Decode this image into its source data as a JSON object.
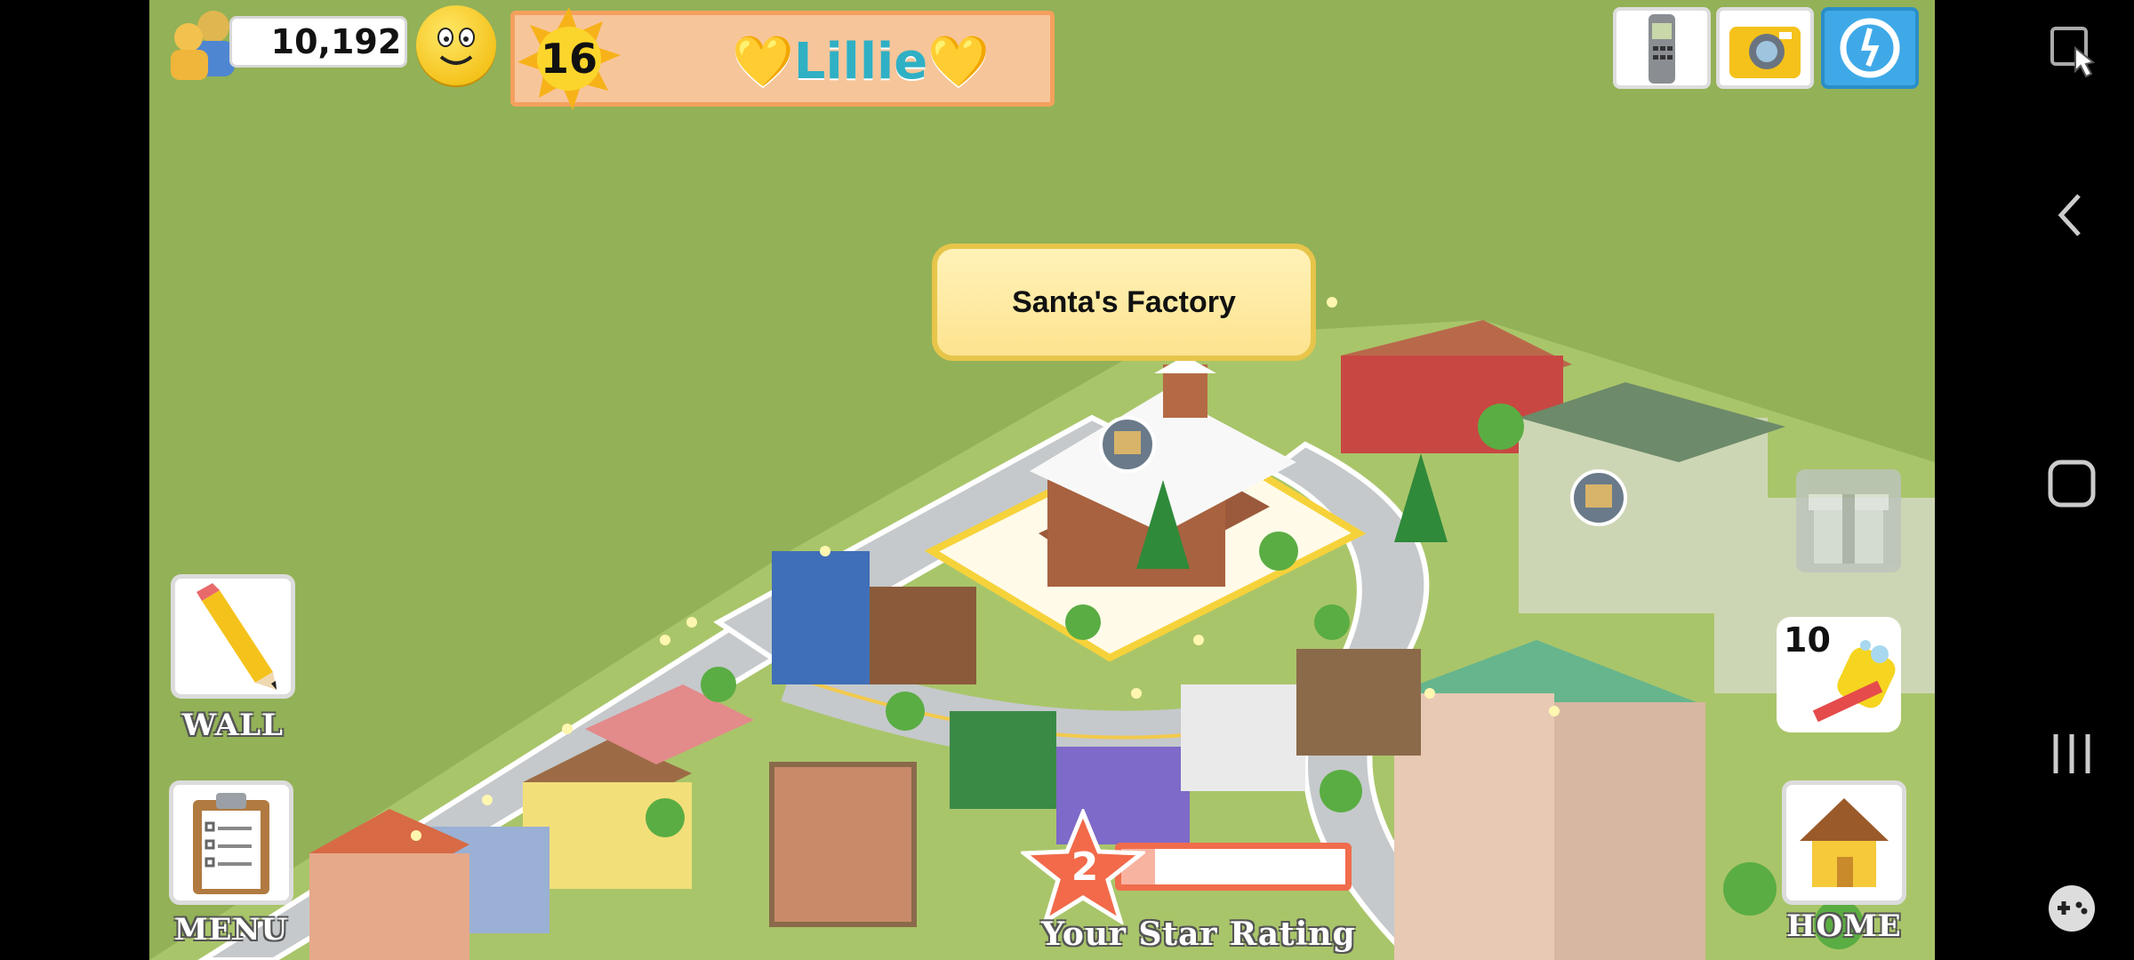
{
  "hud": {
    "population": "10,192",
    "level": "16",
    "player_name": "💛Lillie💛"
  },
  "tooltip": {
    "building_name": "Santa's Factory"
  },
  "left_buttons": {
    "wall_label": "WALL",
    "menu_label": "MENU"
  },
  "right_buttons": {
    "home_label": "HOME",
    "cleanup_count": "10"
  },
  "star_rating": {
    "value": "2",
    "label": "Your Star Rating",
    "progress": 0.15
  },
  "top_right_icons": [
    "phone-icon",
    "camera-icon",
    "social-icon"
  ],
  "colors": {
    "grass": "#93b157",
    "name_text": "#2fb0c4",
    "star_bar_border": "#f06c4c",
    "tooltip_bg": "#fde38f"
  }
}
